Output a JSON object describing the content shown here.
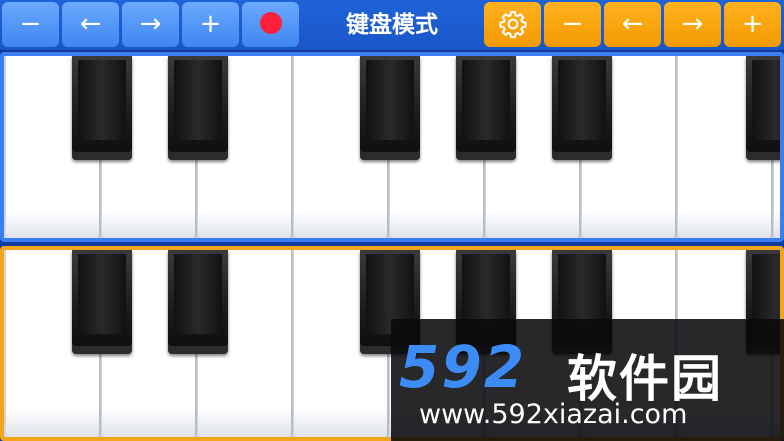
{
  "toolbar": {
    "left_buttons": [
      {
        "label": "−",
        "name": "decrease-octave-button-top"
      },
      {
        "label": "←",
        "name": "shift-left-button-top"
      },
      {
        "label": "→",
        "name": "shift-right-button-top"
      },
      {
        "label": "+",
        "name": "increase-octave-button-top"
      }
    ],
    "title": "键盘模式",
    "right_buttons": [
      {
        "label": "−",
        "name": "decrease-octave-button-bottom"
      },
      {
        "label": "←",
        "name": "shift-left-button-bottom"
      },
      {
        "label": "→",
        "name": "shift-right-button-bottom"
      },
      {
        "label": "+",
        "name": "increase-octave-button-bottom"
      }
    ]
  },
  "colors": {
    "toolbar_bg": "#1a56c8",
    "button_blue": "#4f93f5",
    "button_orange": "#f7a20c",
    "record_dot": "#ff1f3a",
    "top_keyboard_border": "#3b7ef2",
    "bottom_keyboard_border": "#f3a51a"
  },
  "watermark": {
    "logo_number": "592",
    "logo_text": "软件园",
    "url": "www.592xiazai.com"
  }
}
